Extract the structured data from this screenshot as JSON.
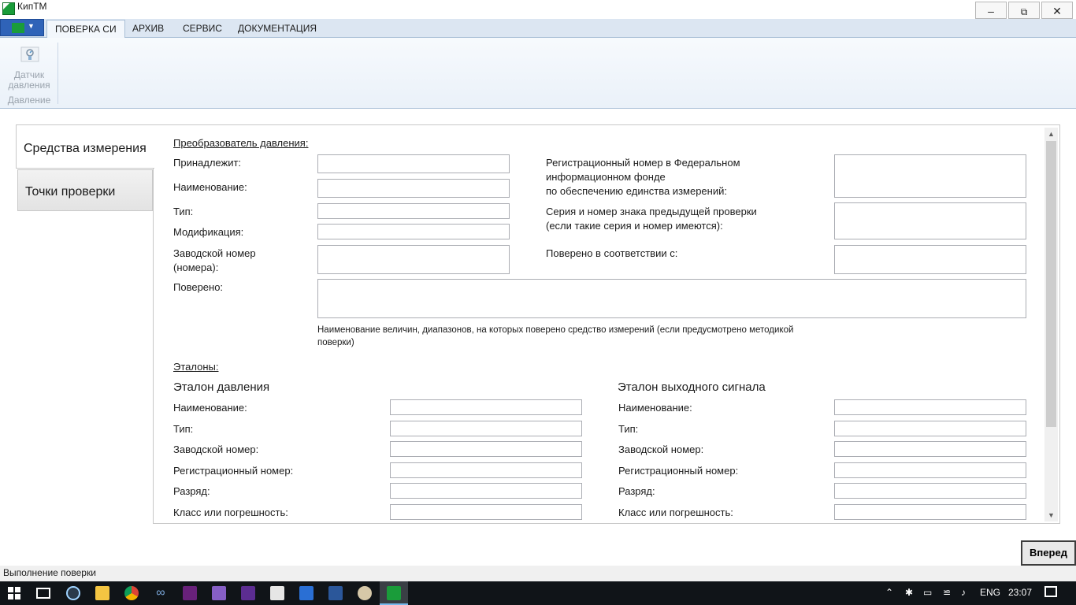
{
  "window": {
    "title": "КипТМ",
    "minimize_icon": "minimize-icon",
    "restore_icon": "restore-icon",
    "close_icon": "close-icon"
  },
  "ribbon": {
    "tabs": [
      "ПОВЕРКА СИ",
      "АРХИВ",
      "СЕРВИС",
      "ДОКУМЕНТАЦИЯ"
    ],
    "active_tab": "ПОВЕРКА СИ",
    "button_label_line1": "Датчик",
    "button_label_line2": "давления",
    "group_label": "Давление"
  },
  "side_tabs": [
    "Средства измерения",
    "Точки проверки"
  ],
  "converter": {
    "section_title": "Преобразователь давления:",
    "owner_label": "Принадлежит:",
    "name_label": "Наименование:",
    "type_label": "Тип:",
    "modification_label": "Модификация:",
    "serial_label_line1": "Заводской номер",
    "serial_label_line2": "(номера):",
    "verified_label": "Поверено:",
    "reg_label_line1": "Регистрационный номер в Федеральном",
    "reg_label_line2": "информационном фонде",
    "reg_label_line3": "по обеспечению единства измерений:",
    "prev_mark_line1": "Серия и номер знака предыдущей проверки",
    "prev_mark_line2": "(если такие серия и номер имеются):",
    "verified_according_label": "Поверено в соответствии с:",
    "hint_line1": "Наименование величин, диапазонов, на которых поверено средство измерений (если предусмотрено методикой",
    "hint_line2": "поверки)",
    "values": {
      "owner": "",
      "name": "",
      "type": "",
      "modification": "",
      "serial": "",
      "verified": "",
      "reg_number": "",
      "prev_mark": "",
      "verified_according": ""
    }
  },
  "standards": {
    "section_title": "Эталоны:",
    "pressure": {
      "title": "Эталон давления",
      "name_label": "Наименование:",
      "type_label": "Тип:",
      "serial_label": "Заводской номер:",
      "reg_label": "Регистрационный номер:",
      "rank_label": "Разряд:",
      "accuracy_label": "Класс или погрешность:"
    },
    "output": {
      "title": "Эталон выходного сигнала",
      "name_label": "Наименование:",
      "type_label": "Тип:",
      "serial_label": "Заводской номер:",
      "reg_label": "Регистрационный номер:",
      "rank_label": "Разряд:",
      "accuracy_label": "Класс или погрешность:"
    }
  },
  "footer": {
    "next_button": "Вперед",
    "status": "Выполнение поверки"
  },
  "taskbar": {
    "lang": "ENG",
    "time": "23:07"
  },
  "colors": {
    "ribbon_tabs_bg": "#dce6f2",
    "app_menu": "#2f63b8",
    "brand_green": "#1a9c3a",
    "taskbar": "#101418"
  }
}
